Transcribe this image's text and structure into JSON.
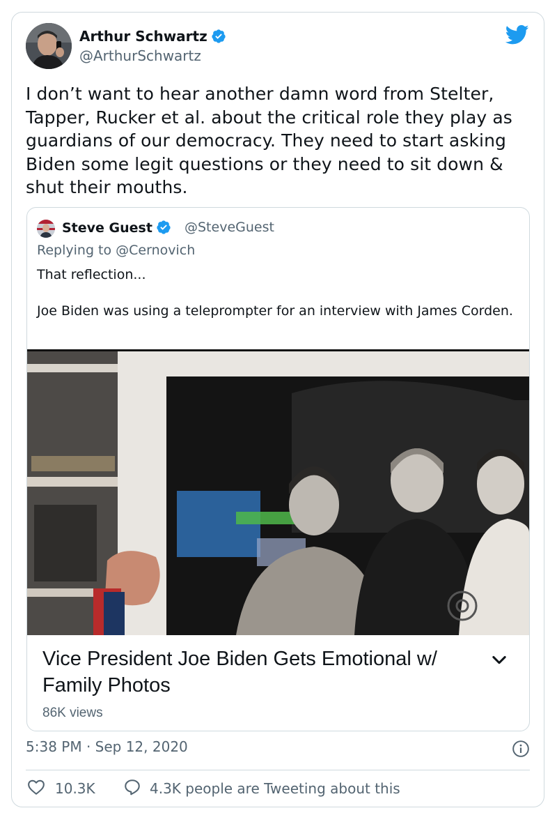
{
  "author": {
    "name": "Arthur Schwartz",
    "handle": "@ArthurSchwartz",
    "verified": true
  },
  "tweet_text": "I don’t want to hear another damn word from Stelter, Tapper, Rucker et al. about the critical role they play as guardians of our democracy. They need to start asking Biden some legit questions or they need to sit down & shut their mouths.",
  "quoted_tweet": {
    "name": "Steve Guest",
    "handle": "@SteveGuest",
    "replying_to": "Replying to @Cernovich",
    "text": "That reflection...\n\nJoe Biden was using a teleprompter for an interview with James Corden.",
    "video_card": {
      "title": "Vice President Joe Biden Gets Emotional w/ Family Photos",
      "views": "86K views"
    }
  },
  "timestamp": "5:38 PM · Sep 12, 2020",
  "engagement": {
    "likes": "10.3K",
    "conversation": "4.3K people are Tweeting about this"
  },
  "colors": {
    "twitter_blue": "#1d9bf0",
    "secondary_text": "#536471",
    "border": "#cfd9de"
  },
  "icons": [
    "verified-badge-icon",
    "twitter-bird-icon",
    "chevron-down-icon",
    "info-icon",
    "heart-icon",
    "speech-bubble-icon"
  ]
}
